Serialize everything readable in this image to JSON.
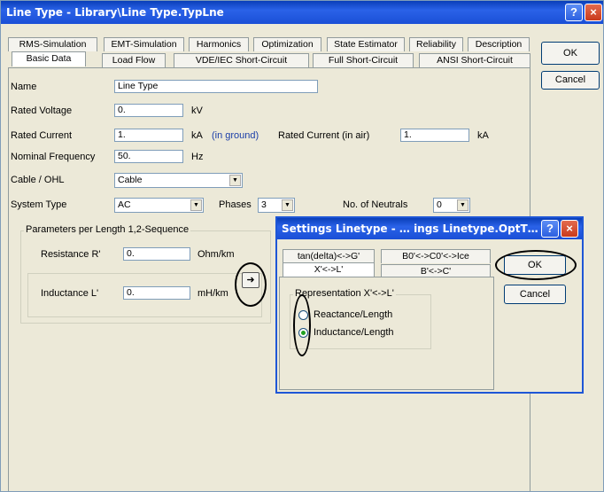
{
  "main": {
    "title": "Line Type - Library\\Line Type.TypLne",
    "tabs_row1": [
      "RMS-Simulation",
      "EMT-Simulation",
      "Harmonics",
      "Optimization",
      "State Estimator",
      "Reliability",
      "Description"
    ],
    "tabs_row2": [
      "Basic Data",
      "Load Flow",
      "VDE/IEC Short-Circuit",
      "Full Short-Circuit",
      "ANSI Short-Circuit"
    ],
    "ok_label": "OK",
    "cancel_label": "Cancel",
    "name_label": "Name",
    "name_value": "Line Type",
    "rated_voltage_label": "Rated Voltage",
    "rated_voltage_value": "0.",
    "rated_voltage_unit": "kV",
    "rated_current_label": "Rated Current",
    "rated_current_value": "1.",
    "rated_current_unit": "kA",
    "in_ground": "(in ground)",
    "rated_current_air_label": "Rated Current (in air)",
    "rated_current_air_value": "1.",
    "rated_current_air_unit": "kA",
    "nominal_frequency_label": "Nominal Frequency",
    "nominal_frequency_value": "50.",
    "nominal_frequency_unit": "Hz",
    "cable_ohl_label": "Cable / OHL",
    "cable_ohl_value": "Cable",
    "system_type_label": "System Type",
    "system_type_value": "AC",
    "phases_label": "Phases",
    "phases_value": "3",
    "neutrals_label": "No. of Neutrals",
    "neutrals_value": "0",
    "params_group_title": "Parameters per Length 1,2-Sequence",
    "resistance_label": "Resistance R'",
    "resistance_value": "0.",
    "resistance_unit": "Ohm/km",
    "inductance_label": "Inductance L'",
    "inductance_value": "0.",
    "inductance_unit": "mH/km",
    "arrow_button": "➜"
  },
  "dialog": {
    "title": "Settings Linetype - … ings Linetype.OptT…",
    "tabs_row1": [
      "tan(delta)<->G'",
      "B0'<->C0'<->Ice"
    ],
    "tabs_row2": [
      "X'<->L'",
      "B'<->C'"
    ],
    "ok_label": "OK",
    "cancel_label": "Cancel",
    "group_title": "Representation X'<->L'",
    "radio_reactance": "Reactance/Length",
    "radio_inductance": "Inductance/Length",
    "selected": "Inductance/Length"
  },
  "icons": {
    "help": "?",
    "close": "×"
  },
  "colors": {
    "title_bar": "#2a62e8",
    "window_bg": "#ece9d8",
    "link_blue": "#1b3ea8"
  }
}
